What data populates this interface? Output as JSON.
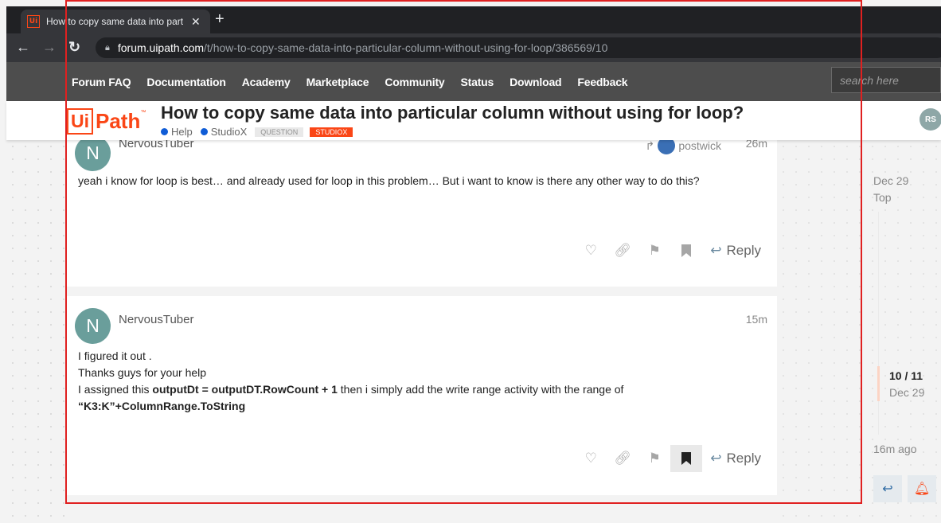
{
  "browser": {
    "tab_title": "How to copy same data into part",
    "favicon_label": "Ui",
    "url_host": "forum.uipath.com",
    "url_path": "/t/how-to-copy-same-data-into-particular-column-without-using-for-loop/386569/10"
  },
  "sitenav": {
    "links": [
      "Forum FAQ",
      "Documentation",
      "Academy",
      "Marketplace",
      "Community",
      "Status",
      "Download",
      "Feedback"
    ],
    "search_placeholder": "search here"
  },
  "header": {
    "logo_ui": "Ui",
    "logo_path": "Path",
    "logo_tm": "™",
    "title": "How to copy same data into particular column without using for loop?",
    "crumbs": [
      "Help",
      "StudioX"
    ],
    "tags": [
      "QUESTION",
      "STUDIOX"
    ],
    "user_initials": "RS"
  },
  "posts": [
    {
      "avatar_letter": "N",
      "username": "NervousTuber",
      "reply_to": "postwick",
      "time": "26m",
      "body_lines": [
        "yeah i know for loop is best… and already used for loop in this problem… But i want to know is there any other way to do this?"
      ],
      "reply_label": "Reply"
    },
    {
      "avatar_letter": "N",
      "username": "NervousTuber",
      "time": "15m",
      "line1": "I figured it out .",
      "line2": "Thanks guys for your help",
      "line3_a": "I assigned this ",
      "line3_b": "outputDt = outputDT.RowCount + 1",
      "line3_c": " then i simply add the write range activity with the range of",
      "line4": "“K3:K”+ColumnRange.ToString",
      "reply_label": "Reply"
    }
  ],
  "timeline": {
    "start_date": "Dec 29",
    "top_label": "Top",
    "position": "10 / 11",
    "position_date": "Dec 29",
    "last_activity": "16m ago"
  },
  "colors": {
    "brand": "#fa4616",
    "highlight": "#e02020",
    "category": "#0f5cd6"
  }
}
